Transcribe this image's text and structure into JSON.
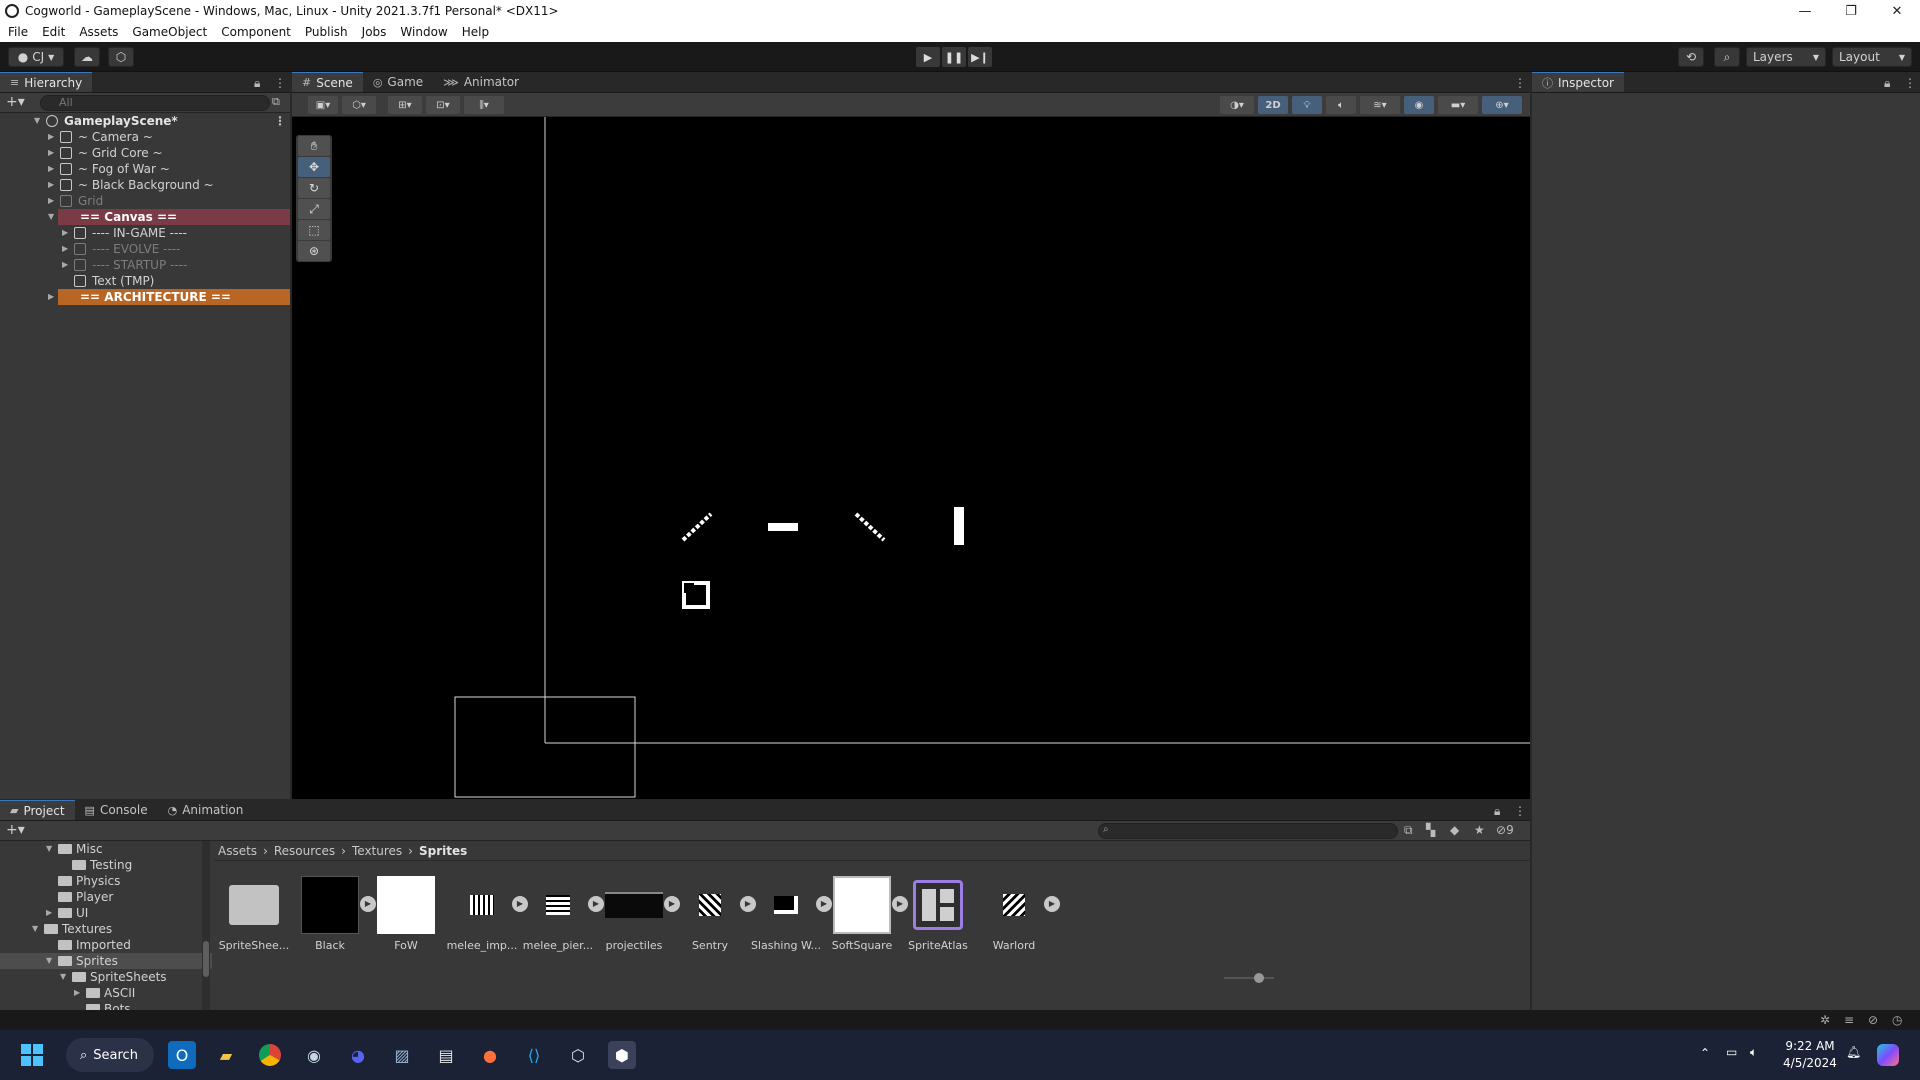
{
  "window": {
    "title": "Cogworld - GameplayScene - Windows, Mac, Linux - Unity 2021.3.7f1 Personal* <DX11>"
  },
  "menu": [
    "File",
    "Edit",
    "Assets",
    "GameObject",
    "Component",
    "Publish",
    "Jobs",
    "Window",
    "Help"
  ],
  "toolbar": {
    "account": "CJ",
    "layers": "Layers",
    "layout": "Layout"
  },
  "hierarchy": {
    "title": "Hierarchy",
    "search_placeholder": "All",
    "scene_name": "GameplayScene*",
    "items": [
      {
        "label": "~ Camera ~"
      },
      {
        "label": "~ Grid Core ~"
      },
      {
        "label": "~ Fog of War ~"
      },
      {
        "label": "~ Black Background ~"
      },
      {
        "label": "Grid"
      },
      {
        "label": "== Canvas =="
      },
      {
        "label": "---- IN-GAME ----"
      },
      {
        "label": "---- EVOLVE ----"
      },
      {
        "label": "---- STARTUP ----"
      },
      {
        "label": "Text (TMP)"
      },
      {
        "label": "== ARCHITECTURE =="
      }
    ]
  },
  "scene": {
    "tabs": [
      "Scene",
      "Game",
      "Animator"
    ],
    "toggle_2d": "2D"
  },
  "inspector": {
    "title": "Inspector"
  },
  "project": {
    "tabs": [
      "Project",
      "Console",
      "Animation"
    ],
    "hidden_count": "9",
    "tree": [
      {
        "label": "Misc"
      },
      {
        "label": "Testing"
      },
      {
        "label": "Physics"
      },
      {
        "label": "Player"
      },
      {
        "label": "UI"
      },
      {
        "label": "Textures"
      },
      {
        "label": "Imported"
      },
      {
        "label": "Sprites"
      },
      {
        "label": "SpriteSheets"
      },
      {
        "label": "ASCII"
      },
      {
        "label": "Bots"
      }
    ],
    "breadcrumb": [
      "Assets",
      "Resources",
      "Textures",
      "Sprites"
    ],
    "assets": [
      {
        "name": "SpriteShee..."
      },
      {
        "name": "Black"
      },
      {
        "name": "FoW"
      },
      {
        "name": "melee_imp..."
      },
      {
        "name": "melee_pier..."
      },
      {
        "name": "projectiles"
      },
      {
        "name": "Sentry"
      },
      {
        "name": "Slashing W..."
      },
      {
        "name": "SoftSquare"
      },
      {
        "name": "SpriteAtlas"
      },
      {
        "name": "Warlord"
      }
    ]
  },
  "taskbar": {
    "search_label": "Search",
    "time": "9:22 AM",
    "date": "4/5/2024"
  }
}
